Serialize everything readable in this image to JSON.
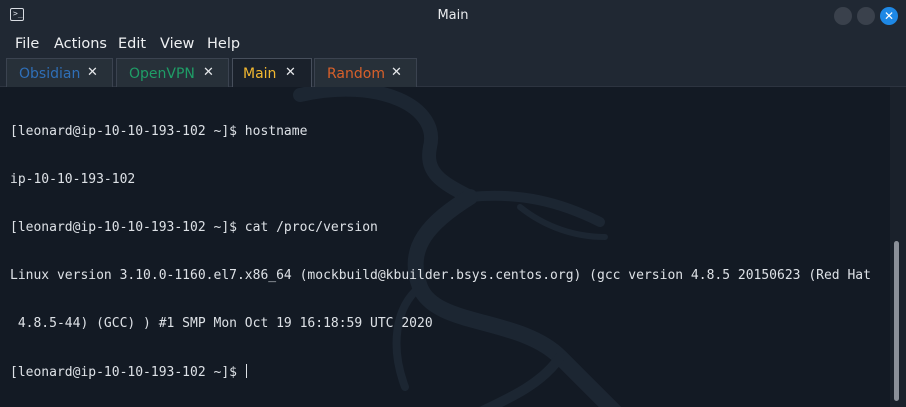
{
  "window": {
    "title": "Main"
  },
  "menu": [
    "File",
    "Actions",
    "Edit",
    "View",
    "Help"
  ],
  "tabs": [
    {
      "label": "Obsidian",
      "color": "#2f6fb8",
      "close": "✕"
    },
    {
      "label": "OpenVPN",
      "color": "#1f9d67",
      "close": "✕"
    },
    {
      "label": "Main",
      "color": "#f2b830",
      "close": "✕",
      "active": true
    },
    {
      "label": "Random",
      "color": "#d8602a",
      "close": "✕"
    }
  ],
  "terminal": {
    "lines": [
      "[leonard@ip-10-10-193-102 ~]$ hostname",
      "ip-10-10-193-102",
      "[leonard@ip-10-10-193-102 ~]$ cat /proc/version",
      "Linux version 3.10.0-1160.el7.x86_64 (mockbuild@kbuilder.bsys.centos.org) (gcc version 4.8.5 20150623 (Red Hat",
      " 4.8.5-44) (GCC) ) #1 SMP Mon Oct 19 16:18:59 UTC 2020",
      "[leonard@ip-10-10-193-102 ~]$ "
    ]
  },
  "colors": {
    "accent": "#1e88e5",
    "background": "#131a24"
  }
}
